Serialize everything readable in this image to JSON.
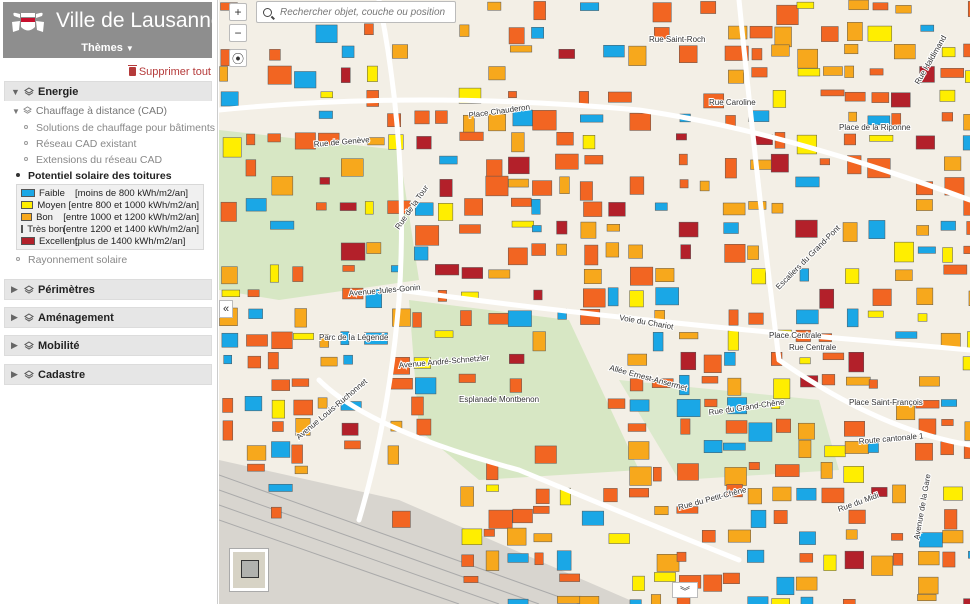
{
  "app": {
    "title": "Ville de Lausanne",
    "themes_label": "Thèmes"
  },
  "toolbar": {
    "delete_all": "Supprimer tout",
    "zoom_in": "+",
    "zoom_out": "−",
    "locate": "⦿",
    "collapse": "«",
    "expand": "»"
  },
  "search": {
    "placeholder": "Rechercher objet, couche ou position"
  },
  "groups": [
    {
      "label": "Energie",
      "expanded": true
    },
    {
      "label": "Périmètres",
      "expanded": false
    },
    {
      "label": "Aménagement",
      "expanded": false
    },
    {
      "label": "Mobilité",
      "expanded": false
    },
    {
      "label": "Cadastre",
      "expanded": false
    }
  ],
  "energie": {
    "sub_group": "Chauffage à distance (CAD)",
    "cad_items": [
      "Solutions de chauffage pour bâtiments",
      "Réseau CAD existant",
      "Extensions du réseau CAD"
    ],
    "active_layer": "Potentiel solaire des toitures",
    "other_layer": "Rayonnement solaire",
    "legend": [
      {
        "cls": "Faible",
        "range": "[moins de 800 kWh/m2/an]",
        "color": "#1aa7e6"
      },
      {
        "cls": "Moyen",
        "range": "[entre 800 et 1000 kWh/m2/an]",
        "color": "#ffee00"
      },
      {
        "cls": "Bon",
        "range": "[entre 1000 et 1200 kWh/m2/an]",
        "color": "#f7a81c"
      },
      {
        "cls": "Très bon",
        "range": "[entre 1200 et 1400 kWh/m2/an]",
        "color": "#f26522"
      },
      {
        "cls": "Excellent",
        "range": "[plus de 1400 kWh/m2/an]",
        "color": "#b3202a"
      }
    ]
  },
  "map": {
    "streets": [
      "Rue Saint-Roch",
      "Place Chauderon",
      "Rue de Genève",
      "Rue de la Tour",
      "Avenue Jules-Gonin",
      "Place de la Riponne",
      "Rue Centrale",
      "Place Centrale",
      "Avenue Louis-Ruchonnet",
      "Esplanade Montbenon",
      "Allée Ernest-Ansermet",
      "Place Saint-François",
      "Route cantonale 1",
      "Rue du Grand-Chêne",
      "Parc de la Légende",
      "Rue du Petit-Chêne",
      "Avenue André-Schnetzler",
      "Rue du Midi",
      "Avenue de la Gare",
      "Rue Caroline",
      "Escaliers du Grand-Pont",
      "Voie du Chariot",
      "Rue Haldimand"
    ]
  }
}
